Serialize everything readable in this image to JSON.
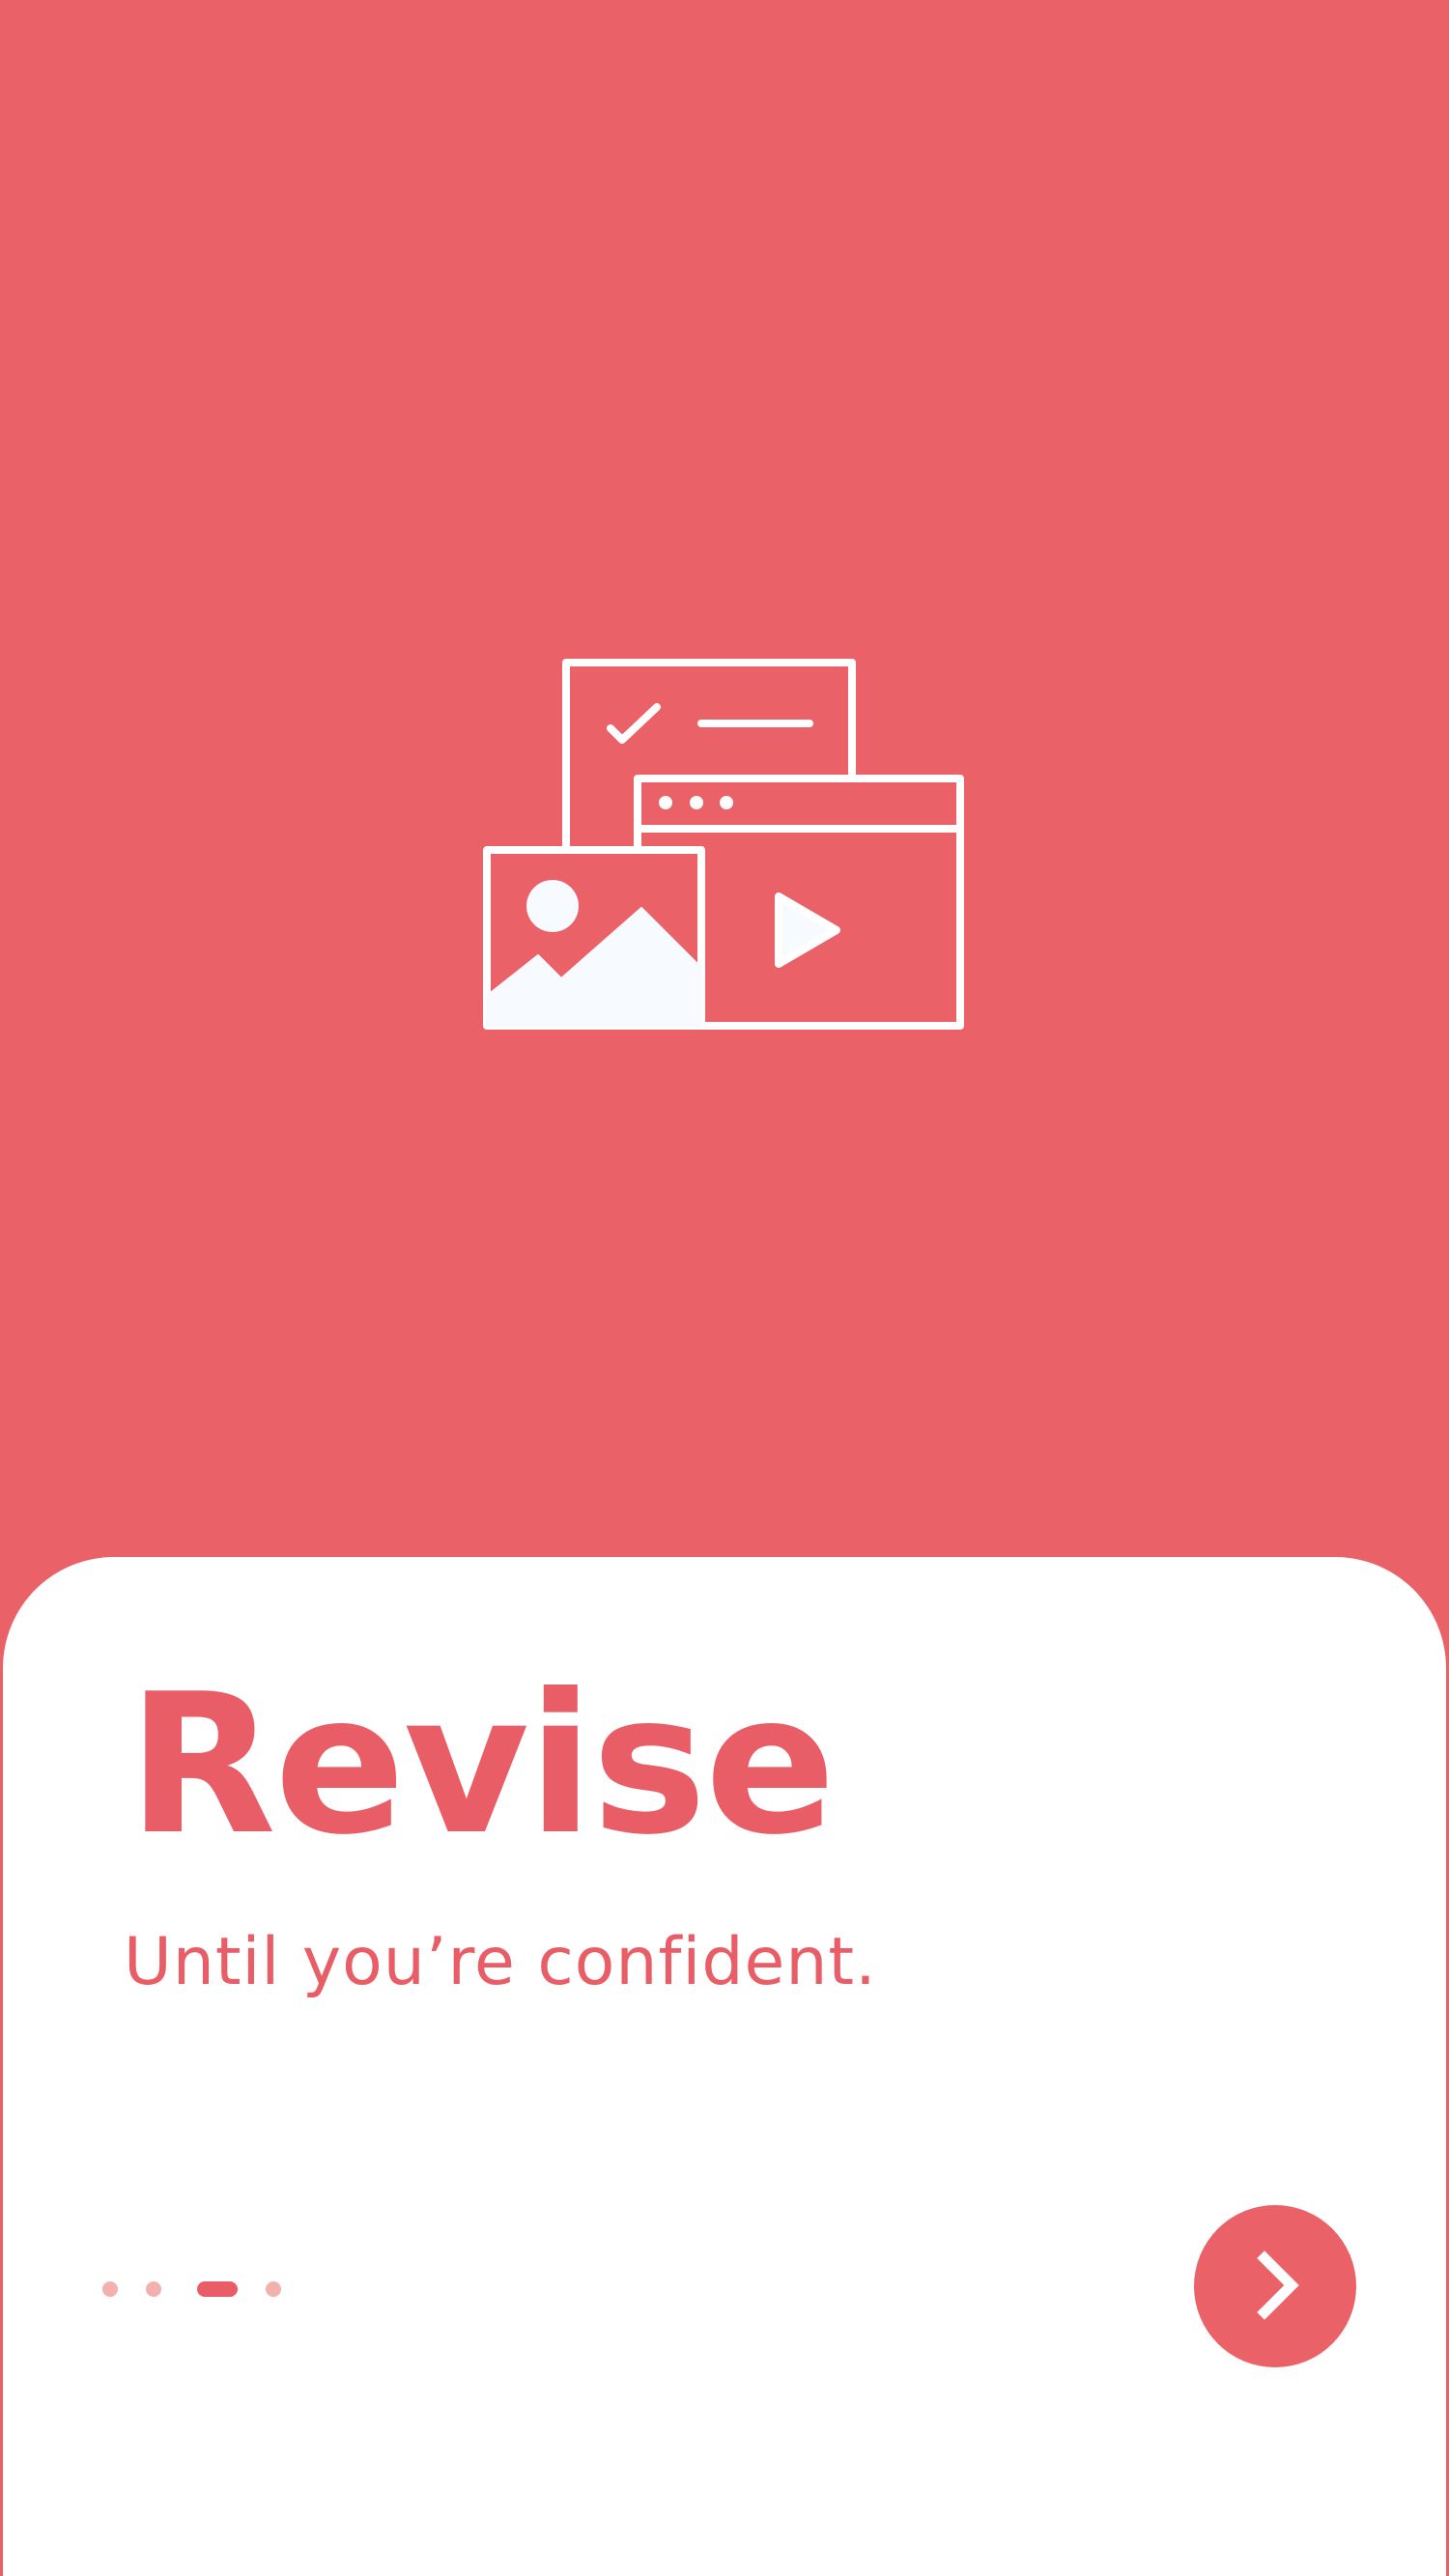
{
  "onboarding": {
    "title": "Revise",
    "subtitle": "Until you’re confident.",
    "pager": {
      "total": 4,
      "current": 3
    },
    "next_icon": "chevron-right-icon",
    "illustration_icon": "revision-materials-icon"
  },
  "colors": {
    "accent": "#EA6167",
    "card": "#FFFFFF",
    "dot_inactive": "#F3B1AE"
  }
}
